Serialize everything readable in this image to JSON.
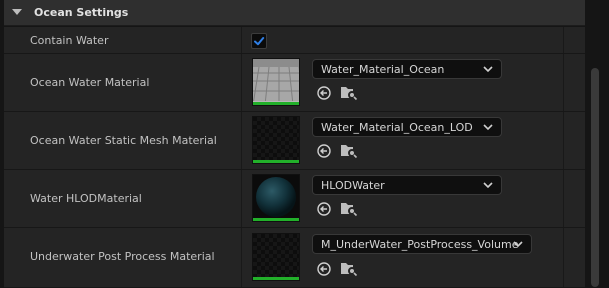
{
  "section": {
    "title": "Ocean Settings"
  },
  "rows": {
    "contain_water": {
      "label": "Contain Water",
      "checked": true
    },
    "ocean_water_material": {
      "label": "Ocean Water Material",
      "value": "Water_Material_Ocean"
    },
    "ocean_static_mesh_material": {
      "label": "Ocean Water Static Mesh Material",
      "value": "Water_Material_Ocean_LOD"
    },
    "water_hlod_material": {
      "label": "Water HLODMaterial",
      "value": "HLODWater"
    },
    "underwater_post_process": {
      "label": "Underwater Post Process Material",
      "value": "M_UnderWater_PostProcess_Volume"
    }
  },
  "icons": {
    "section_toggle": "chevron-down-icon",
    "checkbox": "checkmark-icon",
    "use_selected": "arrow-left-circle-icon",
    "browse": "folder-search-icon",
    "dropdown": "chevron-down-icon"
  },
  "colors": {
    "accent_check": "#2f7fe6",
    "thumbnail_bar": "#22b02a"
  }
}
